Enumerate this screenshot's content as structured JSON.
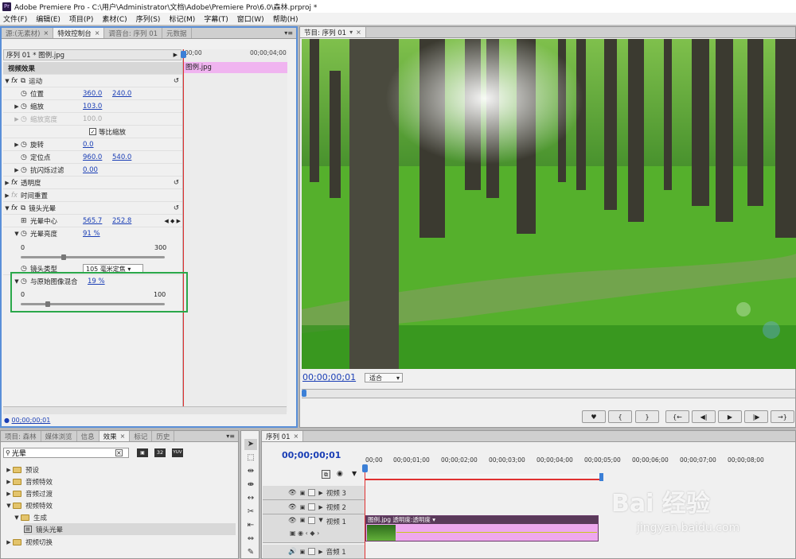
{
  "app": {
    "title": "Adobe Premiere Pro - C:\\用户\\Administrator\\文档\\Adobe\\Premiere Pro\\6.0\\森林.prproj *",
    "icon_text": "Pr"
  },
  "menu": [
    "文件(F)",
    "编辑(E)",
    "项目(P)",
    "素材(C)",
    "序列(S)",
    "标记(M)",
    "字幕(T)",
    "窗口(W)",
    "帮助(H)"
  ],
  "ec_panel": {
    "tabs": [
      "源:(无素材)",
      "特效控制台",
      "调音台: 序列 01",
      "元数据"
    ],
    "active_tab": 1,
    "clip_label": "序列 01 * 图例.jpg",
    "time_start": "00;00",
    "time_end": "00;00;04;00",
    "clip_bar": "图例.jpg",
    "section_video": "视频效果",
    "motion": "运动",
    "position": {
      "label": "位置",
      "x": "360.0",
      "y": "240.0"
    },
    "scale": {
      "label": "缩放",
      "v": "103.0"
    },
    "scale_width": {
      "label": "缩放宽度",
      "v": "100.0"
    },
    "uniform": "等比缩放",
    "rotation": {
      "label": "旋转",
      "v": "0.0"
    },
    "anchor": {
      "label": "定位点",
      "x": "960.0",
      "y": "540.0"
    },
    "flicker": {
      "label": "抗闪烁过滤",
      "v": "0.00"
    },
    "opacity": "透明度",
    "time_remap": "时间重置",
    "lens_flare": "镜头光晕",
    "flare_center": {
      "label": "光晕中心",
      "x": "565.7",
      "y": "252.8"
    },
    "flare_brightness": {
      "label": "光晕亮度",
      "v": "91 %",
      "min": "0",
      "max": "300",
      "fraction": 0.3
    },
    "lens_type": {
      "label": "镜头类型",
      "v": "105 毫米定焦"
    },
    "blend": {
      "label": "与原始图像混合",
      "v": "19 %",
      "min": "0",
      "max": "100",
      "fraction": 0.19
    },
    "current_time": "00;00;00;01"
  },
  "program_monitor": {
    "tab": "节目: 序列 01",
    "timecode": "00;00;00;01",
    "fit": "适合"
  },
  "transport": [
    "♥",
    "{",
    "}",
    "{←",
    "◀|",
    "▶",
    "|▶",
    "→}"
  ],
  "project_panel": {
    "tabs": [
      "项目: 森林",
      "媒体浏览",
      "信息",
      "效果",
      "标记",
      "历史"
    ],
    "active_tab": 3,
    "search_value": "光晕",
    "badges": [
      "32",
      "32",
      "YUV"
    ],
    "tree": [
      {
        "label": "预设",
        "level": 0,
        "open": false
      },
      {
        "label": "音频特效",
        "level": 0,
        "open": false
      },
      {
        "label": "音频过渡",
        "level": 0,
        "open": false
      },
      {
        "label": "视频特效",
        "level": 0,
        "open": true
      },
      {
        "label": "生成",
        "level": 1,
        "open": true
      },
      {
        "label": "镜头光晕",
        "level": 2,
        "open": false
      },
      {
        "label": "视频切换",
        "level": 0,
        "open": false
      }
    ]
  },
  "timeline": {
    "tab": "序列 01",
    "timecode": "00;00;00;01",
    "ruler": [
      "00;00",
      "00;00;01;00",
      "00;00;02;00",
      "00;00;03;00",
      "00;00;04;00",
      "00;00;05;00",
      "00;00;06;00",
      "00;00;07;00",
      "00;00;08;00"
    ],
    "tracks": [
      "视频 3",
      "视频 2",
      "视频 1",
      "音频 1"
    ],
    "clip_label": "图例.jpg 透明度:透明度 ▾"
  },
  "watermark": {
    "text": "Bai 经验",
    "sub": "jingyan.baidu.com"
  },
  "colors": {
    "accent": "#5a8fd8",
    "highlight_box": "#2aa84a",
    "clip": "#e8a8e8",
    "playhead": "#e03030"
  }
}
